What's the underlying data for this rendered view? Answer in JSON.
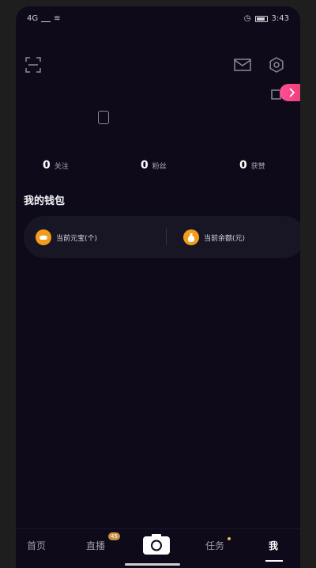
{
  "status": {
    "signal": "4G",
    "time": "3:43"
  },
  "header": {
    "icons": [
      "scan-icon",
      "mail-icon",
      "gear-icon",
      "share-icon",
      "chevron-right-icon"
    ]
  },
  "stats": [
    {
      "num": "0",
      "label": "关注"
    },
    {
      "num": "0",
      "label": "粉丝"
    },
    {
      "num": "0",
      "label": "获赞"
    }
  ],
  "wallet": {
    "title": "我的钱包",
    "items": [
      {
        "label": "当前元宝(个)"
      },
      {
        "label": "当前余额(元)"
      }
    ]
  },
  "tabbar": {
    "items": [
      {
        "label": "首页",
        "active": false
      },
      {
        "label": "直播",
        "active": false,
        "badge": "45"
      },
      {
        "label": "",
        "icon": "camera-icon"
      },
      {
        "label": "任务",
        "active": false,
        "dot": true
      },
      {
        "label": "我",
        "active": true
      }
    ]
  },
  "colors": {
    "background": "#0e0a1a",
    "accent": "#ff4f96",
    "wallet_icon": "#f29c1c"
  }
}
